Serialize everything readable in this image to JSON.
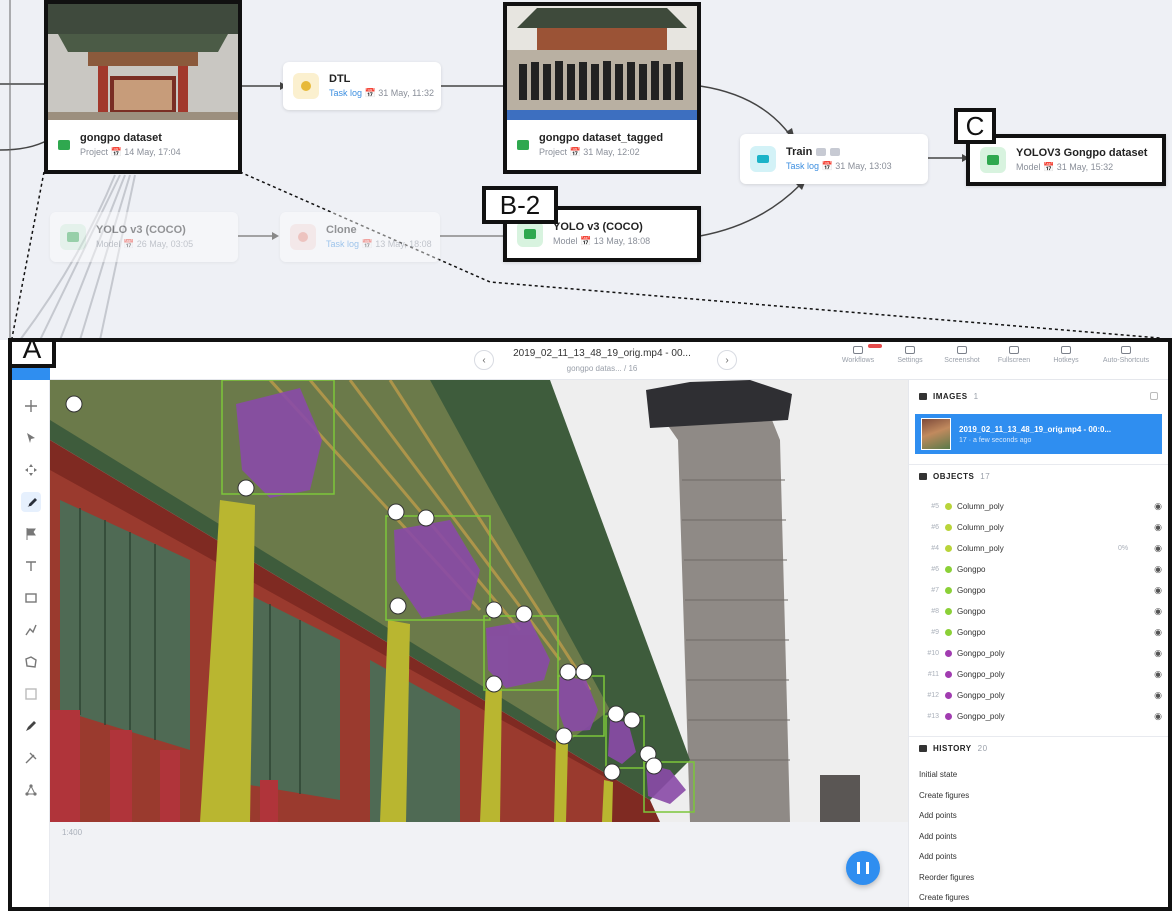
{
  "graph": {
    "nodes": {
      "gongpo_dataset": {
        "title": "gongpo dataset",
        "type": "Project",
        "date": "14 May, 17:04"
      },
      "dtl": {
        "title": "DTL",
        "link": "Task log",
        "date": "31 May, 11:32"
      },
      "gongpo_tagged": {
        "title": "gongpo dataset_tagged",
        "type": "Project",
        "date": "31 May, 12:02"
      },
      "train": {
        "title": "Train",
        "link": "Task log",
        "date": "31 May, 13:03"
      },
      "yolov3_gongpo": {
        "title": "YOLOV3 Gongpo dataset",
        "type": "Model",
        "date": "31 May, 15:32"
      },
      "yolo_coco_faded": {
        "title": "YOLO v3 (COCO)",
        "type": "Model",
        "date": "26 May, 03:05"
      },
      "clone": {
        "title": "Clone",
        "link": "Task log",
        "date": "13 May, 18:08"
      },
      "yolo_coco": {
        "title": "YOLO v3 (COCO)",
        "type": "Model",
        "date": "13 May, 18:08"
      }
    },
    "callouts": {
      "b2": "B-2",
      "c": "C",
      "a": "A"
    }
  },
  "tool": {
    "file_title": "2019_02_11_13_48_19_orig.mp4 - 00...",
    "file_subtitle": "gongpo datas... / 16",
    "header_buttons": [
      "Workflows",
      "Settings",
      "Screenshot",
      "Fullscreen",
      "Hotkeys",
      "Auto-Shortcuts"
    ],
    "zoom": "1:400",
    "images": {
      "header": "IMAGES",
      "count": "1",
      "item_title": "2019_02_11_13_48_19_orig.mp4 - 00:0...",
      "item_meta": "17 · a few seconds ago"
    },
    "objects": {
      "header": "OBJECTS",
      "count": "17",
      "rows": [
        {
          "id": "#5",
          "name": "Column_poly",
          "color": "#b9d43a",
          "pct": ""
        },
        {
          "id": "#6",
          "name": "Column_poly",
          "color": "#b9d43a",
          "pct": ""
        },
        {
          "id": "#4",
          "name": "Column_poly",
          "color": "#b9d43a",
          "pct": "0%"
        },
        {
          "id": "#6",
          "name": "Gongpo",
          "color": "#8bd037",
          "pct": ""
        },
        {
          "id": "#7",
          "name": "Gongpo",
          "color": "#8bd037",
          "pct": ""
        },
        {
          "id": "#8",
          "name": "Gongpo",
          "color": "#8bd037",
          "pct": ""
        },
        {
          "id": "#9",
          "name": "Gongpo",
          "color": "#8bd037",
          "pct": ""
        },
        {
          "id": "#10",
          "name": "Gongpo_poly",
          "color": "#a13cb0",
          "pct": ""
        },
        {
          "id": "#11",
          "name": "Gongpo_poly",
          "color": "#a13cb0",
          "pct": ""
        },
        {
          "id": "#12",
          "name": "Gongpo_poly",
          "color": "#a13cb0",
          "pct": ""
        },
        {
          "id": "#13",
          "name": "Gongpo_poly",
          "color": "#a13cb0",
          "pct": ""
        }
      ]
    },
    "history": {
      "header": "HISTORY",
      "count": "20",
      "items": [
        "Initial state",
        "Create figures",
        "Add points",
        "Add points",
        "Add points",
        "Reorder figures",
        "Create figures"
      ]
    }
  }
}
